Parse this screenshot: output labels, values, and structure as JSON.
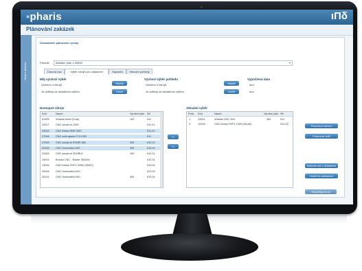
{
  "app": {
    "brand": "pharis",
    "brand_right": "ιΠδ",
    "page_title": "Plánování zakázek",
    "side_tab": "Hlavní stránka"
  },
  "header": {
    "section_label": "Dokladatelé plánování výroby",
    "potvrdit_label": "Potvrdit",
    "combo_value": "Aktuální plán 1-99890"
  },
  "tabs": [
    "Časová osa",
    "Výběr zdrojů pro odstavení",
    "Kapacita",
    "Hlavové pohledy"
  ],
  "active_tab_index": 1,
  "blocks": {
    "moj": {
      "title": "Můj výchozí výběr",
      "line1": "Uloženo 4 zdrojů",
      "line2": "Je odlišný od aktuálního výběru",
      "btn1": "Načíst",
      "btn2": "Uložit"
    },
    "vych": {
      "title": "Výchozí výběr pohledu",
      "line1": "Uloženo 0 zdrojů",
      "line2": "Je odlišný od aktuálního výběru",
      "btn1": "Načíst",
      "btn2": "Uložit"
    },
    "vyp": {
      "title": "Vypočtená data",
      "line1": "ano",
      "line2": "ano"
    }
  },
  "dostupne": {
    "title": "Dostupné zdroje",
    "columns": [
      "Kód",
      "Název",
      "Výrobní plán",
      "Stř"
    ],
    "rows": [
      {
        "kod": "51309",
        "nazev": "Vrtačka stolní (V-ka)",
        "plan": "100",
        "str": "511",
        "hl": false
      },
      {
        "kod": "22007",
        "nazev": "CNC soustruh 100S",
        "plan": "",
        "str": "511.01",
        "hl": false
      },
      {
        "kod": "24002",
        "nazev": "CNC frézka SMS 3/5C",
        "plan": "",
        "str": "511.01",
        "hl": true
      },
      {
        "kod": "27006",
        "nazev": "CNC centrujacka TGH 500",
        "plan": "",
        "str": "511",
        "hl": true
      },
      {
        "kod": "27005",
        "nazev": "CNC soustruh POMR 380",
        "plan": "300",
        "str": "512.01",
        "hl": true
      },
      {
        "kod": "22405",
        "nazev": "CNC Horizontka H40",
        "plan": "300",
        "str": "513.04",
        "hl": true
      },
      {
        "kod": "22463",
        "nazev": "CNC soustruh 3DOBLE",
        "plan": "100",
        "str": "512.01",
        "hl": false
      },
      {
        "kod": "24002",
        "nazev": "Bruska CNC - Bluder 3DGAN",
        "plan": "",
        "str": "512.01",
        "hl": false
      },
      {
        "kod": "13006",
        "nazev": "CNC frézka FNTX 3/500 (SNEC)",
        "plan": "",
        "str": "513.04",
        "hl": false
      },
      {
        "kod": "20006",
        "nazev": "CNC Horizontka H40",
        "plan": "",
        "str": "513.04",
        "hl": false
      },
      {
        "kod": "25102",
        "nazev": "CNC Horizontka H40",
        "plan": "400",
        "str": "513.04",
        "hl": false
      }
    ]
  },
  "aktualni": {
    "title": "Aktuální výběr",
    "columns": [
      "Pořa",
      "Kód",
      "Název",
      "Výrobní plán",
      "Stř"
    ],
    "rows": [
      {
        "por": "1",
        "kod": "22001",
        "nazev": "Vrtačka CNC 3X0",
        "plan": "300",
        "str": "511"
      },
      {
        "por": "2",
        "kod": "12206",
        "nazev": "CNC frézka FNTX 1000 (SILAE)",
        "plan": "",
        "str": "513.03"
      }
    ]
  },
  "transfer": {
    "add": ">>",
    "remove": "<<"
  },
  "side_buttons": [
    "Posunout nahoru",
    "Posunout dolů",
    "Nulovat vše v oblastech",
    "Uložit do oblastech"
  ],
  "footer_button": "Nakonfigurovat"
}
